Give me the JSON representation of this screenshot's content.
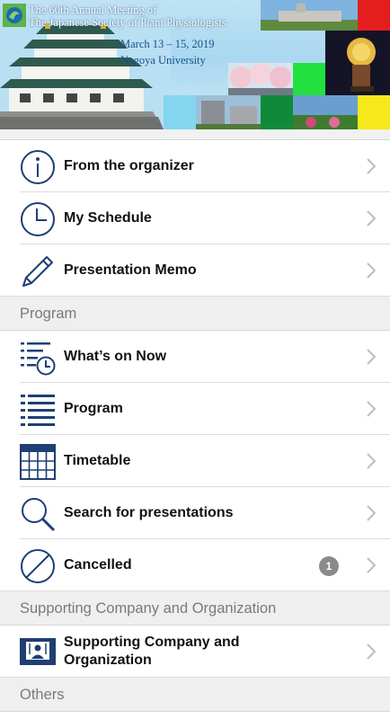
{
  "banner": {
    "title_line1": "The 60th Annual Meeting of",
    "title_line2": "The Japanese Society of Plant Physiologists",
    "dates": "March 13 – 15, 2019",
    "venue": "Nagoya University"
  },
  "menu_top": [
    {
      "label": "From the organizer",
      "icon": "info-icon"
    },
    {
      "label": "My Schedule",
      "icon": "clock-icon"
    },
    {
      "label": "Presentation Memo",
      "icon": "pencil-icon"
    }
  ],
  "sections": {
    "program": {
      "title": "Program",
      "items": [
        {
          "label": "What’s on Now",
          "icon": "list-clock-icon"
        },
        {
          "label": "Program",
          "icon": "list-icon"
        },
        {
          "label": "Timetable",
          "icon": "calendar-grid-icon"
        },
        {
          "label": "Search for presentations",
          "icon": "search-icon"
        },
        {
          "label": "Cancelled",
          "icon": "cancel-icon",
          "badge": "1"
        }
      ]
    },
    "supporting": {
      "title": "Supporting Company and Organization",
      "items": [
        {
          "label_line1": "Supporting Company and",
          "label_line2": "Organization",
          "icon": "presenter-icon"
        }
      ]
    },
    "others": {
      "title": "Others"
    }
  },
  "colors": {
    "icon_blue": "#1f3f73",
    "chevron": "#bdbdbd",
    "section_bg": "#efefef",
    "badge_bg": "#8a8a8a"
  }
}
